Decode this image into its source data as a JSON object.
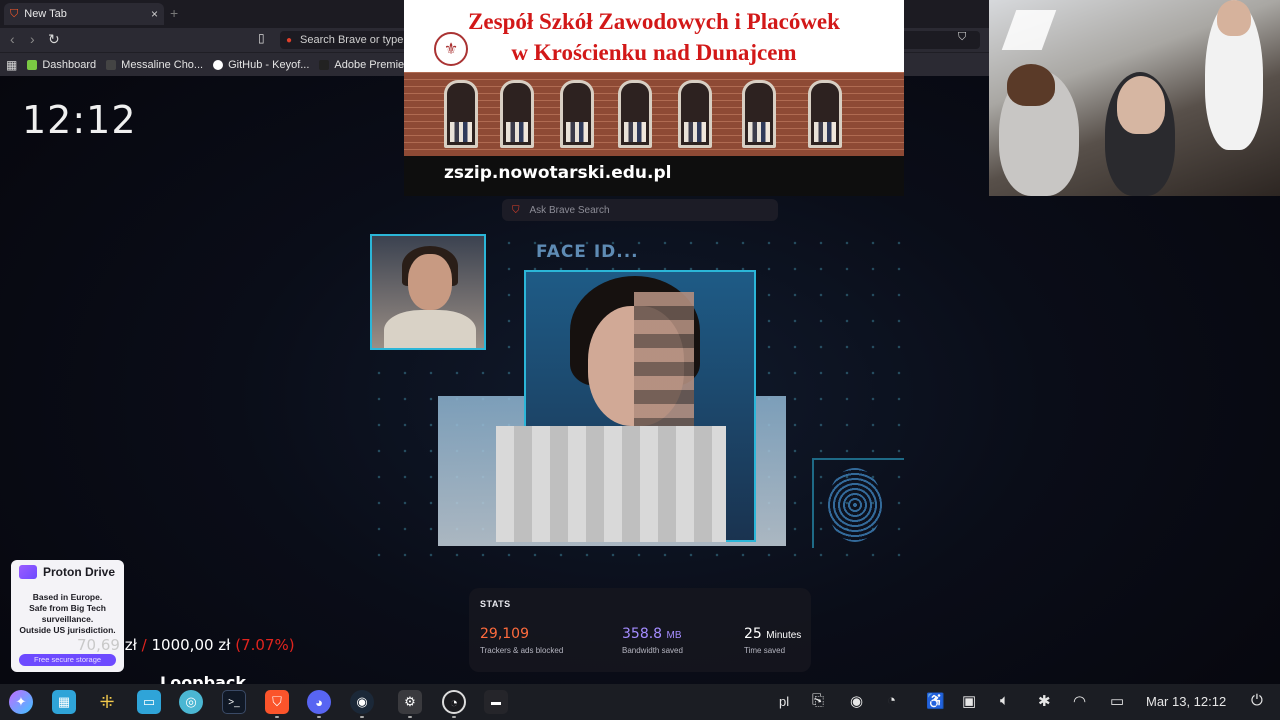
{
  "browser": {
    "tab_title": "New Tab",
    "tab_close": "×",
    "new_tab": "+",
    "url_placeholder": "Search Brave or type a",
    "bookmarks": [
      {
        "label": "Dashboard",
        "color": "#7ac943"
      },
      {
        "label": "Messaline Cho...",
        "color": "#444444"
      },
      {
        "label": "GitHub - Keyof...",
        "color": "#ffffff"
      },
      {
        "label": "Adobe Premie...",
        "color": "#222222"
      }
    ]
  },
  "clock": "12:12",
  "banner": {
    "line1": "Zespół Szkół Zawodowych i Placówek",
    "line2": "w Krościenku nad Dunajcem",
    "url": "zszip.nowotarski.edu.pl"
  },
  "ask_search": "Ask Brave Search",
  "face_id_label": "FACE ID...",
  "stats": {
    "heading": "STATS",
    "trackers_value": "29,109",
    "trackers_label": "Trackers & ads blocked",
    "bandwidth_value": "358.8",
    "bandwidth_unit": "MB",
    "bandwidth_label": "Bandwidth saved",
    "time_value": "25",
    "time_unit": "Minutes",
    "time_label": "Time saved"
  },
  "proton": {
    "name": "Proton Drive",
    "body_lines": [
      "Based in Europe.",
      "Safe from Big Tech",
      "surveillance.",
      "Outside US jurisdiction."
    ],
    "cta": "Free secure storage"
  },
  "donation": {
    "current": "70,69",
    "currency": "zł",
    "separator": "/",
    "goal": "1000,00 zł",
    "percent": "(7.07%)"
  },
  "loopback": "Loopback",
  "taskbar": {
    "language": "pl",
    "datetime": "Mar 13, 12:12"
  },
  "colors": {
    "accent_cyan": "#2bb6d8",
    "trackers": "#ff6b3d",
    "bandwidth": "#a48cff",
    "donation_red": "#e0241e"
  }
}
